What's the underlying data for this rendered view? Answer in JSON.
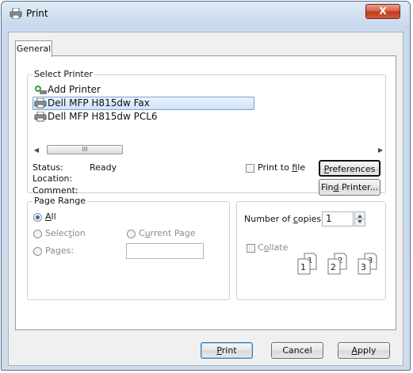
{
  "window": {
    "title": "Print",
    "close_label": "X"
  },
  "tabs": [
    {
      "label": "General"
    }
  ],
  "select_printer": {
    "legend": "Select Printer",
    "printers": [
      {
        "label": "Add Printer",
        "icon": "add-printer-icon"
      },
      {
        "label": "Dell MFP H815dw Fax",
        "icon": "printer-icon",
        "selected": true
      },
      {
        "label": "Dell MFP H815dw PCL6",
        "icon": "printer-icon"
      }
    ],
    "scroll_thumb": "III",
    "status_label": "Status:",
    "status_value": "Ready",
    "location_label": "Location:",
    "comment_label": "Comment:",
    "print_to_file": {
      "prefix": "Print to ",
      "underlined": "f",
      "suffix": "ile",
      "checked": false
    },
    "preferences_button": {
      "underlined": "P",
      "rest": "references"
    },
    "find_printer_button": {
      "prefix": "Fin",
      "underlined": "d",
      "rest": " Printer..."
    }
  },
  "page_range": {
    "legend": "Page Range",
    "options": [
      {
        "prefix": "",
        "underlined": "A",
        "rest": "ll",
        "checked": true,
        "enabled": true
      },
      {
        "prefix": "Selec",
        "underlined": "t",
        "rest": "ion",
        "checked": false,
        "enabled": false
      },
      {
        "prefix": "C",
        "underlined": "u",
        "rest": "rrent Page",
        "checked": false,
        "enabled": false
      },
      {
        "prefix": "Pa",
        "underlined": "g",
        "rest": "es:",
        "checked": false,
        "enabled": false
      }
    ],
    "pages_value": ""
  },
  "copies": {
    "label_prefix": "Number of ",
    "label_underlined": "c",
    "label_rest": "opies:",
    "value": "1",
    "collate": {
      "prefix": "C",
      "underlined": "o",
      "rest": "llate",
      "checked": false,
      "enabled": false
    },
    "collate_sets": [
      {
        "back": "1",
        "front": "1"
      },
      {
        "back": "2",
        "front": "2"
      },
      {
        "back": "3",
        "front": "3"
      }
    ]
  },
  "footer": {
    "print": {
      "underlined": "P",
      "rest": "rint"
    },
    "cancel": "Cancel",
    "apply": {
      "underlined": "A",
      "rest": "pply"
    }
  },
  "colors": {
    "accent": "#2b6fb8",
    "close": "#c0391f",
    "selection": "#cfe3f9"
  }
}
